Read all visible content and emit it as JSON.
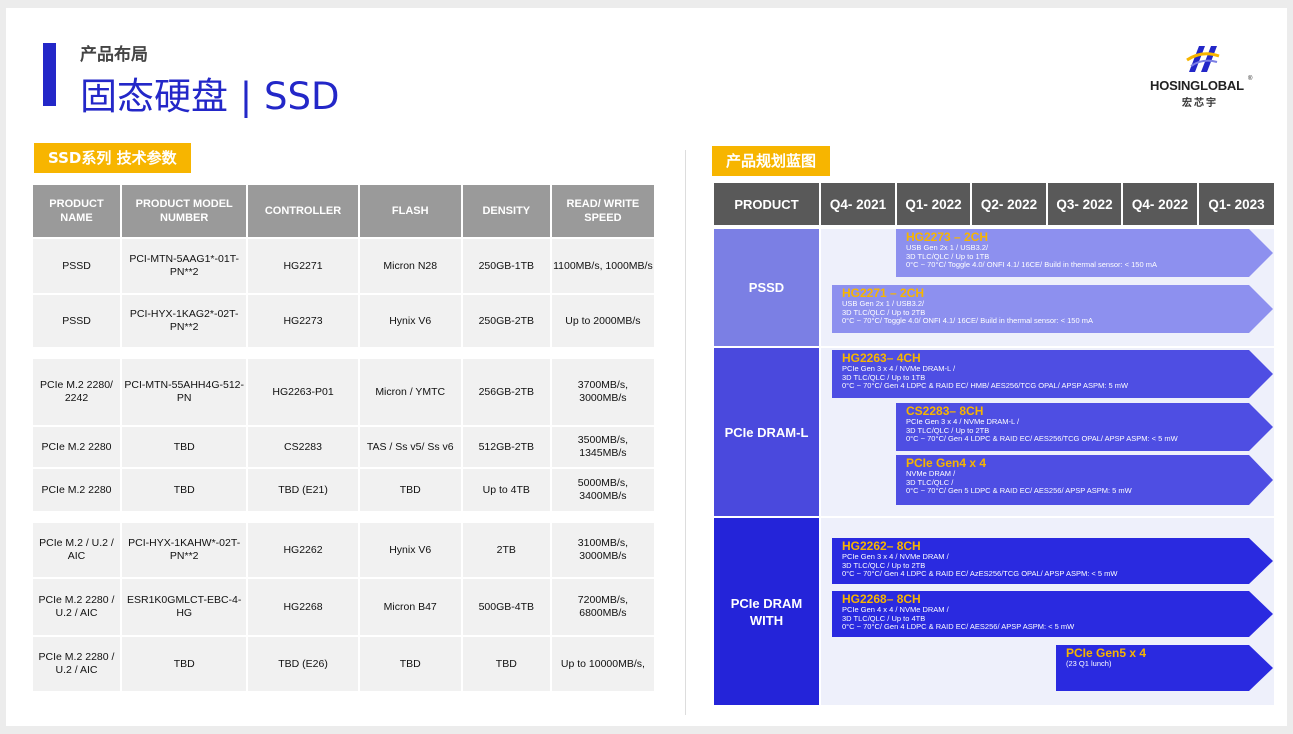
{
  "header": {
    "subtitle": "产品布局",
    "title": "固态硬盘 | SSD"
  },
  "logo": {
    "brand": "HOSINGLOBAL",
    "reg": "®",
    "cn": "宏芯宇"
  },
  "left": {
    "section_label": "SSD系列 技术参数",
    "columns": [
      "PRODUCT NAME",
      "PRODUCT MODEL NUMBER",
      "CONTROLLER",
      "FLASH",
      "DENSITY",
      "READ/ WRITE SPEED"
    ],
    "groups": [
      {
        "rows": [
          [
            "PSSD",
            "PCI-MTN-5AAG1*-01T-PN**2",
            "HG2271",
            "Micron N28",
            "250GB-1TB",
            "1100MB/s, 1000MB/s"
          ],
          [
            "PSSD",
            "PCI-HYX-1KAG2*-02T-PN**2",
            "HG2273",
            "Hynix V6",
            "250GB-2TB",
            "Up to 2000MB/s"
          ]
        ]
      },
      {
        "rows": [
          [
            "PCIe M.2 2280/ 2242",
            "PCI-MTN-55AHH4G-512-PN",
            "HG2263-P01",
            "Micron / YMTC",
            "256GB-2TB",
            "3700MB/s, 3000MB/s"
          ],
          [
            "PCIe M.2 2280",
            "TBD",
            "CS2283",
            "TAS / Ss v5/ Ss v6",
            "512GB-2TB",
            "3500MB/s, 1345MB/s"
          ],
          [
            "PCIe M.2 2280",
            "TBD",
            "TBD (E21)",
            "TBD",
            "Up to 4TB",
            "5000MB/s, 3400MB/s"
          ]
        ]
      },
      {
        "rows": [
          [
            "PCIe M.2 / U.2 / AIC",
            "PCI-HYX-1KAHW*-02T-PN**2",
            "HG2262",
            "Hynix V6",
            "2TB",
            "3100MB/s, 3000MB/s"
          ],
          [
            "PCIe M.2 2280 / U.2 / AIC",
            "ESR1K0GMLCT-EBC-4-HG",
            "HG2268",
            "Micron B47",
            "500GB-4TB",
            "7200MB/s, 6800MB/s"
          ],
          [
            "PCIe M.2 2280 / U.2 / AIC",
            "TBD",
            "TBD (E26)",
            "TBD",
            "TBD",
            "Up to 10000MB/s,"
          ]
        ]
      }
    ]
  },
  "right": {
    "section_label": "产品规划蓝图",
    "product_header": "PRODUCT",
    "quarters": [
      "Q4- 2021",
      "Q1- 2022",
      "Q2- 2022",
      "Q3- 2022",
      "Q4- 2022",
      "Q1- 2023"
    ],
    "rows": [
      {
        "label": "PSSD",
        "color": "#7b7fe4"
      },
      {
        "label": "PCIe DRAM-L",
        "color": "#4a49dd"
      },
      {
        "label": "PCIe DRAM WITH",
        "color": "#2424d9"
      }
    ],
    "arrows": [
      {
        "name": "HG2273 – 2CH",
        "color": "#8d90ef",
        "lines": [
          "USB Gen 2x 1 / USB3.2/",
          "3D TLC/QLC / Up to 1TB",
          "0°C ~ 70°C/ Toggle 4.0/ ONFI 4.1/ 16CE/ Build in thermal sensor: < 150 mA"
        ]
      },
      {
        "name": "HG2271 – 2CH",
        "color": "#8d90ef",
        "lines": [
          "USB Gen 2x 1 / USB3.2/",
          "3D TLC/QLC / Up to 2TB",
          "0°C ~ 70°C/ Toggle 4.0/ ONFI 4.1/ 16CE/ Build in thermal sensor: < 150 mA"
        ]
      },
      {
        "name": "HG2263– 4CH",
        "color": "#4e4ee3",
        "lines": [
          "PCIe Gen 3 x 4 / NVMe DRAM-L /",
          "3D TLC/QLC / Up to 1TB",
          "0°C ~ 70°C/ Gen 4 LDPC & RAID EC/ HMB/ AES256/TCG OPAL/ APSP ASPM: 5 mW"
        ]
      },
      {
        "name": "CS2283– 8CH",
        "color": "#4e4ee3",
        "lines": [
          "PCIe Gen 3 x 4 / NVMe DRAM-L /",
          "3D TLC/QLC / Up to 2TB",
          "0°C ~ 70°C/ Gen 4 LDPC & RAID EC/ AES256/TCG OPAL/ APSP ASPM: < 5 mW"
        ]
      },
      {
        "name": "PCIe Gen4 x 4",
        "color": "#4e4ee3",
        "lines": [
          "NVMe DRAM /",
          "3D TLC/QLC /",
          "0°C ~ 70°C/ Gen 5 LDPC & RAID EC/ AES256/ APSP ASPM: 5 mW"
        ]
      },
      {
        "name": "HG2262– 8CH",
        "color": "#2a2ae0",
        "lines": [
          "PCIe Gen 3 x 4 / NVMe DRAM /",
          "3D TLC/QLC / Up to 2TB",
          "0°C ~ 70°C/ Gen 4 LDPC & RAID EC/ AzES256/TCG OPAL/ APSP ASPM: < 5 mW"
        ]
      },
      {
        "name": "HG2268– 8CH",
        "color": "#2a2ae0",
        "lines": [
          "PCIe Gen 4 x 4 / NVMe DRAM /",
          "3D TLC/QLC / Up to 4TB",
          "0°C ~ 70°C/ Gen 4 LDPC & RAID EC/ AES256/ APSP ASPM: < 5 mW"
        ]
      },
      {
        "name": "PCIe Gen5 x 4",
        "color": "#2a2ae0",
        "lines": [
          "(23 Q1 lunch)"
        ]
      }
    ]
  }
}
